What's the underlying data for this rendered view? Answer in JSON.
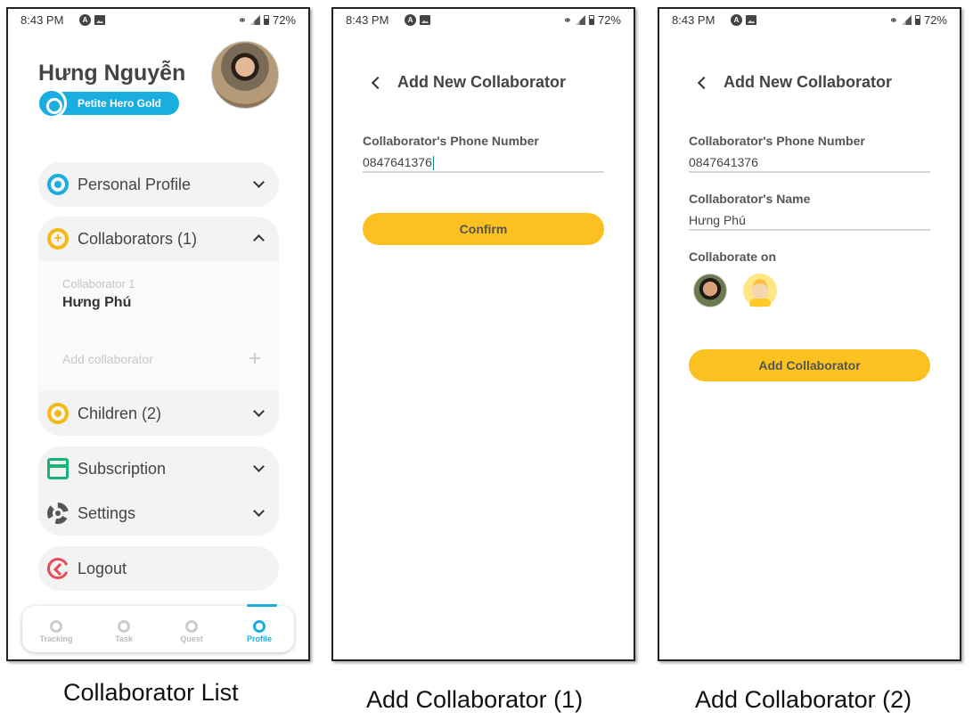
{
  "status_bar": {
    "time": "8:43 PM",
    "battery": "72%"
  },
  "screen1": {
    "user_name": "Hưng Nguyễn",
    "badge": "Petite Hero Gold",
    "menu": {
      "personal_profile": "Personal Profile",
      "collaborators": "Collaborators (1)",
      "collaborator_caption": "Collaborator 1",
      "collaborator_name": "Hưng Phú",
      "add_collaborator": "Add collaborator",
      "add_plus": "+",
      "children": "Children (2)",
      "subscription": "Subscription",
      "settings": "Settings",
      "logout": "Logout"
    },
    "nav": {
      "tracking": "Tracking",
      "task": "Task",
      "quest": "Quest",
      "profile": "Profile"
    }
  },
  "screen2": {
    "title": "Add New Collaborator",
    "phone_label": "Collaborator's Phone Number",
    "phone_value": "0847641376",
    "confirm": "Confirm"
  },
  "screen3": {
    "title": "Add New Collaborator",
    "phone_label": "Collaborator's Phone Number",
    "phone_value": "0847641376",
    "name_label": "Collaborator's Name",
    "name_value": "Hưng Phú",
    "collaborate_label": "Collaborate on",
    "add_button": "Add Collaborator"
  },
  "captions": {
    "c1": "Collaborator List",
    "c2": "Add Collaborator (1)",
    "c3": "Add Collaborator (2)"
  },
  "colors": {
    "accent_blue": "#1aaee0",
    "accent_yellow": "#fbc121",
    "green": "#17b377",
    "red": "#e94a5a"
  }
}
